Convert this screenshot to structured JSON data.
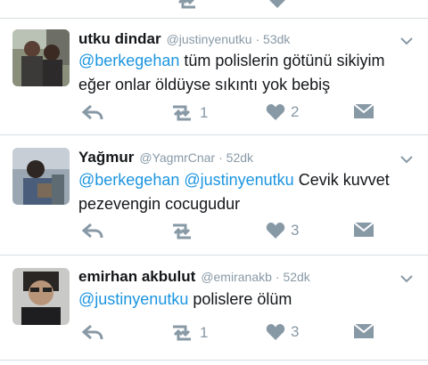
{
  "tweets": [
    {
      "name": "utku dindar",
      "handle": "@justinyenutku",
      "time": "· 53dk",
      "text_mention": "@berkegehan",
      "text_rest": " tüm polislerin götünü sikiyim",
      "text_line2": "eğer onlar öldüyse sıkıntı yok bebiş",
      "retweets": "1",
      "likes": "2"
    },
    {
      "name": "Yağmur",
      "handle": "@YagmrCnar",
      "time": "· 52dk",
      "text_mention": "@berkegehan @justinyenutku",
      "text_rest": " Cevik kuvvet",
      "text_line2": "pezevengin cocugudur",
      "retweets": "",
      "likes": "3"
    },
    {
      "name": "emirhan akbulut",
      "handle": "@emiranakb",
      "time": "· 52dk",
      "text_mention": "@justinyenutku",
      "text_rest": " polislere ölüm",
      "text_line2": "",
      "retweets": "1",
      "likes": "3"
    }
  ],
  "icons": {
    "reply": "reply-icon",
    "retweet": "retweet-icon",
    "like": "heart-icon",
    "dm": "envelope-icon",
    "more": "chevron-down-icon"
  },
  "colors": {
    "mention": "#1b95e0",
    "meta": "#8899a6",
    "icon": "#8899a6",
    "separator": "#d9dee2"
  }
}
